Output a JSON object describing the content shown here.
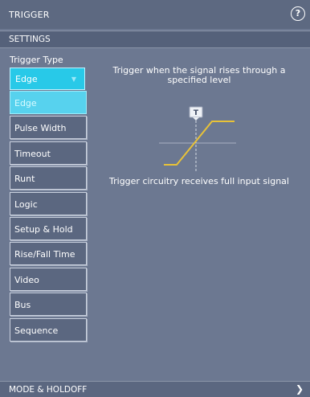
{
  "header": {
    "title": "TRIGGER",
    "help_symbol": "?"
  },
  "settings": {
    "label": "SETTINGS"
  },
  "trigger_type": {
    "label": "Trigger Type",
    "selected": "Edge",
    "options": [
      "Edge",
      "Pulse Width",
      "Timeout",
      "Runt",
      "Logic",
      "Setup & Hold",
      "Rise/Fall Time",
      "Video",
      "Bus",
      "Sequence"
    ]
  },
  "description": {
    "line1": "Trigger when the signal rises through a specified level",
    "line2": "Trigger circuitry receives full input signal",
    "marker": "T"
  },
  "footer": {
    "label": "MODE & HOLDOFF",
    "arrow": "❯"
  },
  "colors": {
    "accent": "#28c9e8",
    "waveform": "#e8c238",
    "background": "#6c7891"
  }
}
